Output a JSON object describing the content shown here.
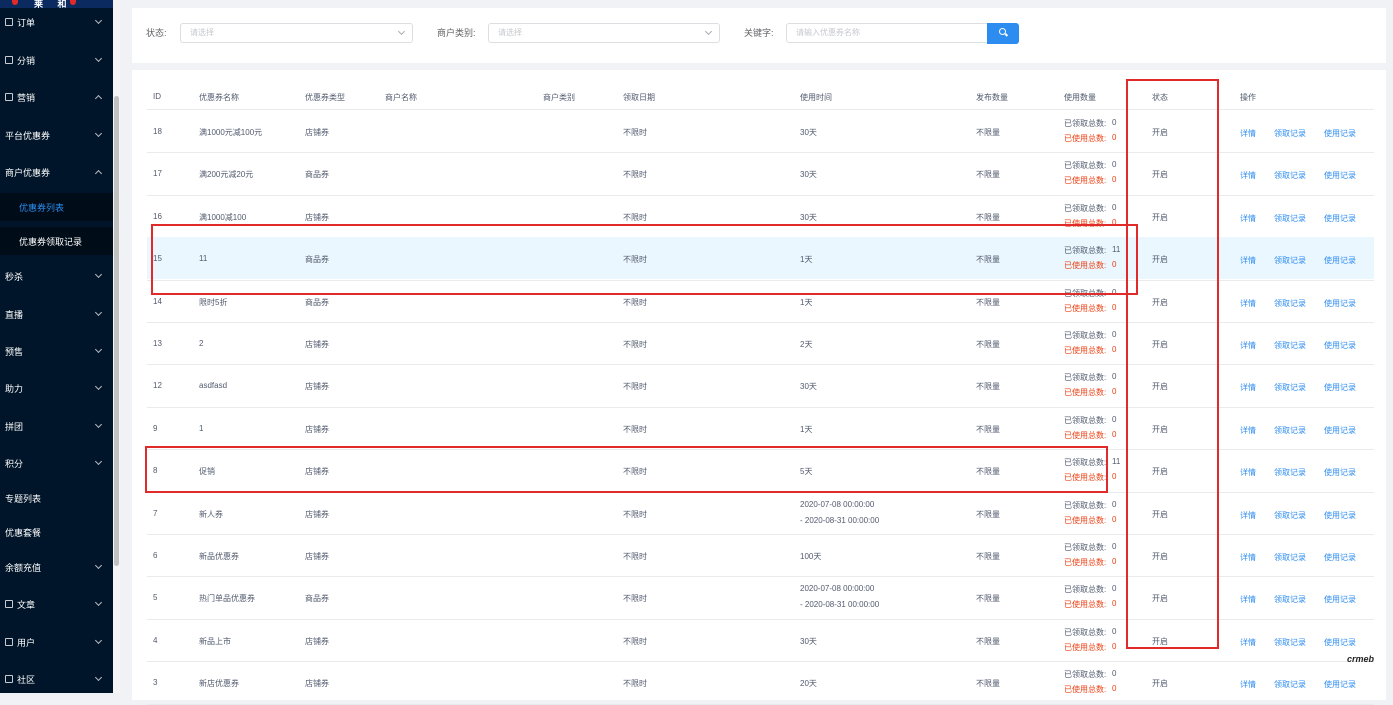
{
  "sidebar": {
    "logo_text": "莱 和",
    "items": [
      {
        "label": "订单",
        "chevron": "down"
      },
      {
        "label": "分销",
        "chevron": "down"
      },
      {
        "label": "营销",
        "chevron": "up"
      },
      {
        "label": "平台优惠券",
        "chevron": "down"
      },
      {
        "label": "商户优惠券",
        "chevron": "up"
      },
      {
        "label": "优惠券列表",
        "chevron": ""
      },
      {
        "label": "优惠券领取记录",
        "chevron": ""
      },
      {
        "label": "秒杀",
        "chevron": "down"
      },
      {
        "label": "直播",
        "chevron": "down"
      },
      {
        "label": "预售",
        "chevron": "down"
      },
      {
        "label": "助力",
        "chevron": "down"
      },
      {
        "label": "拼团",
        "chevron": "down"
      },
      {
        "label": "积分",
        "chevron": "down"
      },
      {
        "label": "专题列表",
        "chevron": ""
      },
      {
        "label": "优惠套餐",
        "chevron": ""
      },
      {
        "label": "余额充值",
        "chevron": "down"
      },
      {
        "label": "文章",
        "chevron": "down"
      },
      {
        "label": "用户",
        "chevron": "down"
      },
      {
        "label": "社区",
        "chevron": "down"
      }
    ]
  },
  "filters": {
    "status_label": "状态:",
    "status_placeholder": "请选择",
    "merchant_type_label": "商户类别:",
    "merchant_type_placeholder": "请选择",
    "keyword_label": "关键字:",
    "keyword_placeholder": "请输入优惠券名称"
  },
  "table": {
    "headers": [
      "ID",
      "优惠券名称",
      "优惠券类型",
      "商户名称",
      "商户类别",
      "领取日期",
      "使用时间",
      "发布数量",
      "使用数量",
      "状态",
      "操作"
    ],
    "received_prefix": "已领取总数:",
    "used_prefix": "已使用总数:",
    "rows": [
      {
        "id": "18",
        "name": "满1000元减100元",
        "type": "店铺券",
        "date": "不限时",
        "use_time": [
          "30天"
        ],
        "publish": "不限量",
        "received": "0",
        "used": "0",
        "status": "开启"
      },
      {
        "id": "17",
        "name": "满200元减20元",
        "type": "商品券",
        "date": "不限时",
        "use_time": [
          "30天"
        ],
        "publish": "不限量",
        "received": "0",
        "used": "0",
        "status": "开启"
      },
      {
        "id": "16",
        "name": "满1000减100",
        "type": "店铺券",
        "date": "不限时",
        "use_time": [
          "30天"
        ],
        "publish": "不限量",
        "received": "0",
        "used": "0",
        "status": "开启"
      },
      {
        "id": "15",
        "name": "11",
        "type": "商品券",
        "date": "不限时",
        "use_time": [
          "1天"
        ],
        "publish": "不限量",
        "received": "11",
        "used": "0",
        "status": "开启"
      },
      {
        "id": "14",
        "name": "限时5折",
        "type": "商品券",
        "date": "不限时",
        "use_time": [
          "1天"
        ],
        "publish": "不限量",
        "received": "0",
        "used": "0",
        "status": "开启"
      },
      {
        "id": "13",
        "name": "2",
        "type": "店铺券",
        "date": "不限时",
        "use_time": [
          "2天"
        ],
        "publish": "不限量",
        "received": "0",
        "used": "0",
        "status": "开启"
      },
      {
        "id": "12",
        "name": "asdfasd",
        "type": "店铺券",
        "date": "不限时",
        "use_time": [
          "30天"
        ],
        "publish": "不限量",
        "received": "0",
        "used": "0",
        "status": "开启"
      },
      {
        "id": "9",
        "name": "1",
        "type": "店铺券",
        "date": "不限时",
        "use_time": [
          "1天"
        ],
        "publish": "不限量",
        "received": "0",
        "used": "0",
        "status": "开启"
      },
      {
        "id": "8",
        "name": "促销",
        "type": "店铺券",
        "date": "不限时",
        "use_time": [
          "5天"
        ],
        "publish": "不限量",
        "received": "11",
        "used": "0",
        "status": "开启"
      },
      {
        "id": "7",
        "name": "新人券",
        "type": "店铺券",
        "date": "不限时",
        "use_time": [
          "2020-07-08 00:00:00",
          "- 2020-08-31 00:00:00"
        ],
        "publish": "不限量",
        "received": "0",
        "used": "0",
        "status": "开启"
      },
      {
        "id": "6",
        "name": "新品优惠券",
        "type": "店铺券",
        "date": "不限时",
        "use_time": [
          "100天"
        ],
        "publish": "不限量",
        "received": "0",
        "used": "0",
        "status": "开启"
      },
      {
        "id": "5",
        "name": "热门单品优惠券",
        "type": "商品券",
        "date": "不限时",
        "use_time": [
          "2020-07-08 00:00:00",
          "- 2020-08-31 00:00:00"
        ],
        "publish": "不限量",
        "received": "0",
        "used": "0",
        "status": "开启"
      },
      {
        "id": "4",
        "name": "新品上市",
        "type": "店铺券",
        "date": "不限时",
        "use_time": [
          "30天"
        ],
        "publish": "不限量",
        "received": "0",
        "used": "0",
        "status": "开启"
      },
      {
        "id": "3",
        "name": "新店优惠券",
        "type": "店铺券",
        "date": "不限时",
        "use_time": [
          "20天"
        ],
        "publish": "不限量",
        "received": "0",
        "used": "0",
        "status": "开启"
      }
    ],
    "actions": [
      "详情",
      "领取记录",
      "使用记录"
    ]
  },
  "watermark": "crmeb",
  "colors": {
    "sidebar_bg": "#001529",
    "accent": "#2d8cf0",
    "used_red": "#ed4014",
    "annotation_red": "#e12a2a",
    "row_highlight": "#ebf7ff"
  }
}
